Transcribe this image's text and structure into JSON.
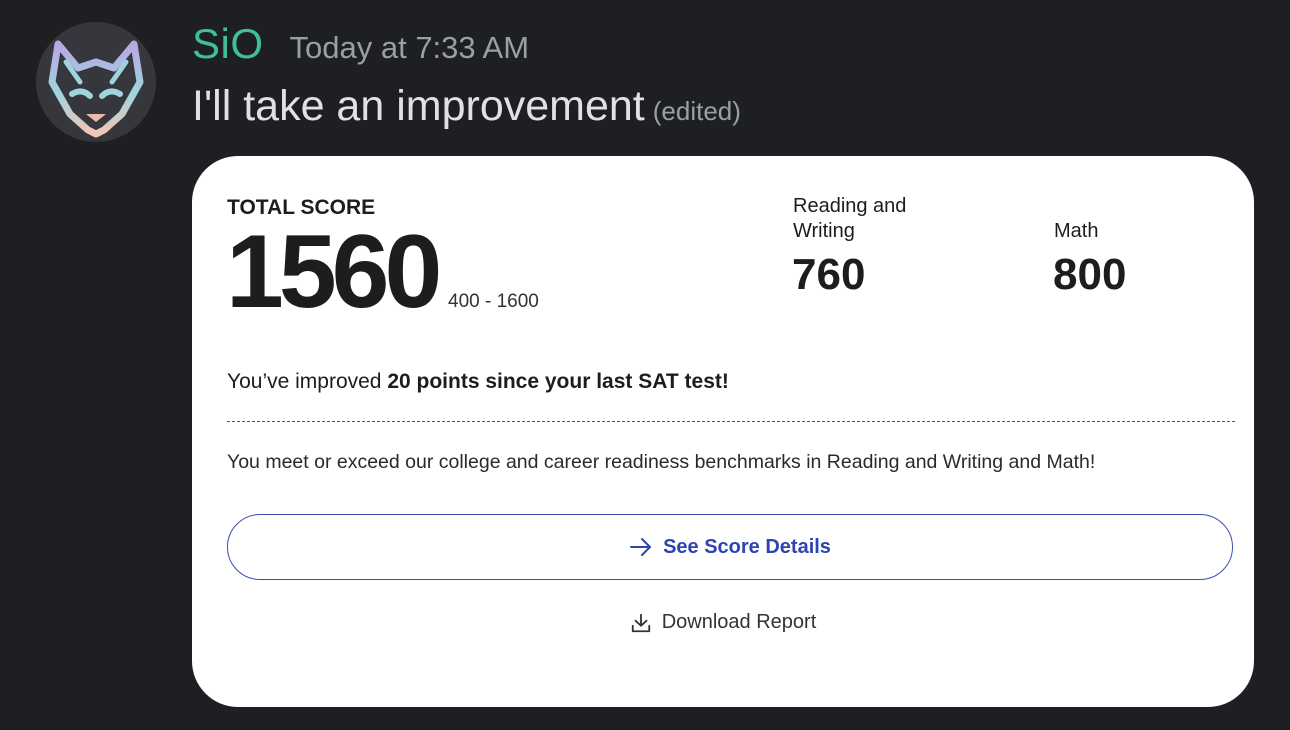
{
  "message": {
    "username": "SiO",
    "timestamp": "Today at 7:33 AM",
    "text": "I'll take an improvement",
    "edited_label": "(edited)",
    "avatar_icon": "wolf-avatar-icon"
  },
  "colors": {
    "background": "#1e1f22",
    "username": "#3fbf94",
    "link_blue": "#2e44b3"
  },
  "score_card": {
    "total_label": "TOTAL SCORE",
    "total_value": "1560",
    "total_range": "400 - 1600",
    "sections": [
      {
        "label": "Reading and Writing",
        "value": "760"
      },
      {
        "label": "Math",
        "value": "800"
      }
    ],
    "improved_prefix": "You’ve improved ",
    "improved_bold": "20 points since your last SAT test!",
    "benchmark_text": "You meet or exceed our college and career readiness benchmarks in Reading and Writing and Math!",
    "details_button_label": "See Score Details",
    "details_button_icon": "arrow-right-icon",
    "download_label": "Download Report",
    "download_icon": "download-icon"
  }
}
